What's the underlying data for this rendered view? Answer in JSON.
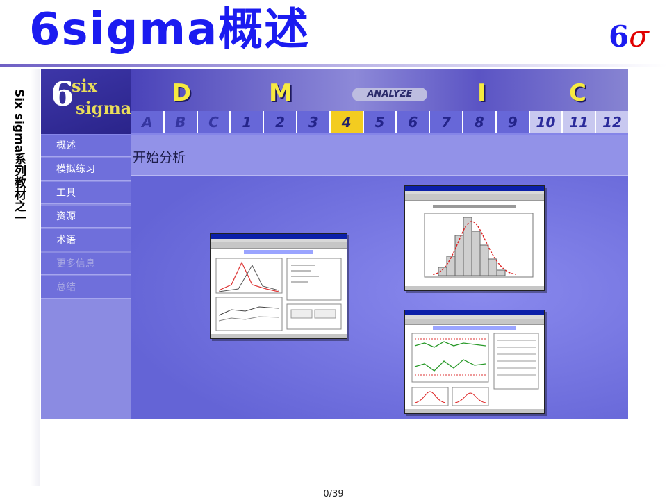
{
  "slide": {
    "title": "6sigma概述",
    "logo_number": "6",
    "logo_sigma": "σ",
    "side_caption": "Six sigma系列教材之一",
    "page_counter": "0/39"
  },
  "app": {
    "logo": {
      "six": "6",
      "word_top": "six",
      "word_bottom": "sigma"
    },
    "phases": [
      "D",
      "M",
      "I",
      "C"
    ],
    "analyze_label": "ANALYZE",
    "steps": [
      "A",
      "B",
      "C",
      "1",
      "2",
      "3",
      "4",
      "5",
      "6",
      "7",
      "8",
      "9",
      "10",
      "11",
      "12"
    ],
    "active_step": "4",
    "menu": [
      {
        "label": "概述",
        "enabled": true
      },
      {
        "label": "模拟练习",
        "enabled": true
      },
      {
        "label": "工具",
        "enabled": true
      },
      {
        "label": "资源",
        "enabled": true
      },
      {
        "label": "术语",
        "enabled": true
      },
      {
        "label": "更多信息",
        "enabled": false
      },
      {
        "label": "总结",
        "enabled": false
      }
    ],
    "content_title": "开始分析"
  },
  "colors": {
    "title_blue": "#1b1bf0",
    "sigma_red": "#e00000",
    "active_step": "#f3cc20",
    "phase_letters": "#f6ea40"
  }
}
